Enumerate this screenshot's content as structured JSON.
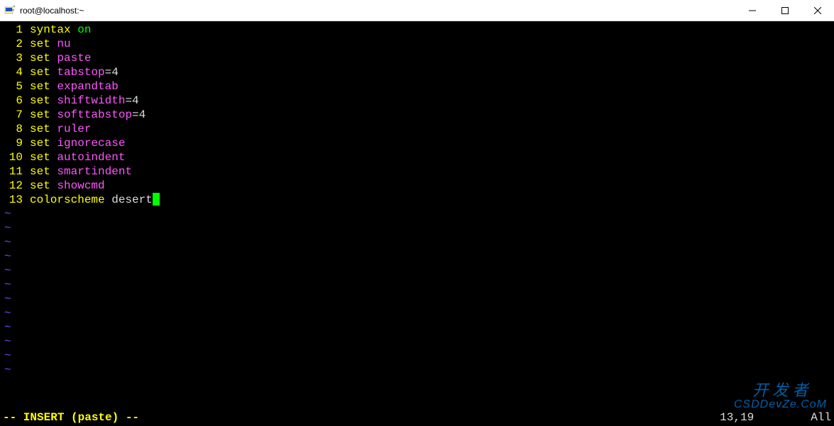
{
  "window": {
    "title": "root@localhost:~"
  },
  "editor": {
    "lines": [
      {
        "n": "1",
        "tokens": [
          {
            "t": "syntax",
            "c": "kw-yellow"
          },
          {
            "t": " ",
            "c": "kw-white"
          },
          {
            "t": "on",
            "c": "kw-green"
          }
        ]
      },
      {
        "n": "2",
        "tokens": [
          {
            "t": "set",
            "c": "kw-yellow"
          },
          {
            "t": " ",
            "c": "kw-white"
          },
          {
            "t": "nu",
            "c": "kw-magenta"
          }
        ]
      },
      {
        "n": "3",
        "tokens": [
          {
            "t": "set",
            "c": "kw-yellow"
          },
          {
            "t": " ",
            "c": "kw-white"
          },
          {
            "t": "paste",
            "c": "kw-magenta"
          }
        ]
      },
      {
        "n": "4",
        "tokens": [
          {
            "t": "set",
            "c": "kw-yellow"
          },
          {
            "t": " ",
            "c": "kw-white"
          },
          {
            "t": "tabstop",
            "c": "kw-magenta"
          },
          {
            "t": "=4",
            "c": "kw-white"
          }
        ]
      },
      {
        "n": "5",
        "tokens": [
          {
            "t": "set",
            "c": "kw-yellow"
          },
          {
            "t": " ",
            "c": "kw-white"
          },
          {
            "t": "expandtab",
            "c": "kw-magenta"
          }
        ]
      },
      {
        "n": "6",
        "tokens": [
          {
            "t": "set",
            "c": "kw-yellow"
          },
          {
            "t": " ",
            "c": "kw-white"
          },
          {
            "t": "shiftwidth",
            "c": "kw-magenta"
          },
          {
            "t": "=4",
            "c": "kw-white"
          }
        ]
      },
      {
        "n": "7",
        "tokens": [
          {
            "t": "set",
            "c": "kw-yellow"
          },
          {
            "t": " ",
            "c": "kw-white"
          },
          {
            "t": "softtabstop",
            "c": "kw-magenta"
          },
          {
            "t": "=4",
            "c": "kw-white"
          }
        ]
      },
      {
        "n": "8",
        "tokens": [
          {
            "t": "set",
            "c": "kw-yellow"
          },
          {
            "t": " ",
            "c": "kw-white"
          },
          {
            "t": "ruler",
            "c": "kw-magenta"
          }
        ]
      },
      {
        "n": "9",
        "tokens": [
          {
            "t": "set",
            "c": "kw-yellow"
          },
          {
            "t": " ",
            "c": "kw-white"
          },
          {
            "t": "ignorecase",
            "c": "kw-magenta"
          }
        ]
      },
      {
        "n": "10",
        "tokens": [
          {
            "t": "set",
            "c": "kw-yellow"
          },
          {
            "t": " ",
            "c": "kw-white"
          },
          {
            "t": "autoindent",
            "c": "kw-magenta"
          }
        ]
      },
      {
        "n": "11",
        "tokens": [
          {
            "t": "set",
            "c": "kw-yellow"
          },
          {
            "t": " ",
            "c": "kw-white"
          },
          {
            "t": "smartindent",
            "c": "kw-magenta"
          }
        ]
      },
      {
        "n": "12",
        "tokens": [
          {
            "t": "set",
            "c": "kw-yellow"
          },
          {
            "t": " ",
            "c": "kw-white"
          },
          {
            "t": "showcmd",
            "c": "kw-magenta"
          }
        ]
      },
      {
        "n": "13",
        "tokens": [
          {
            "t": "colorscheme",
            "c": "kw-yellow"
          },
          {
            "t": " desert",
            "c": "kw-white"
          }
        ],
        "cursor": true
      }
    ],
    "emptyLineCount": 12
  },
  "status": {
    "mode": "-- INSERT (paste) --",
    "pos": "13,19",
    "scroll": "All"
  },
  "watermark": {
    "top": "开 发 者",
    "bot": "CSDDevZe.CoM"
  }
}
